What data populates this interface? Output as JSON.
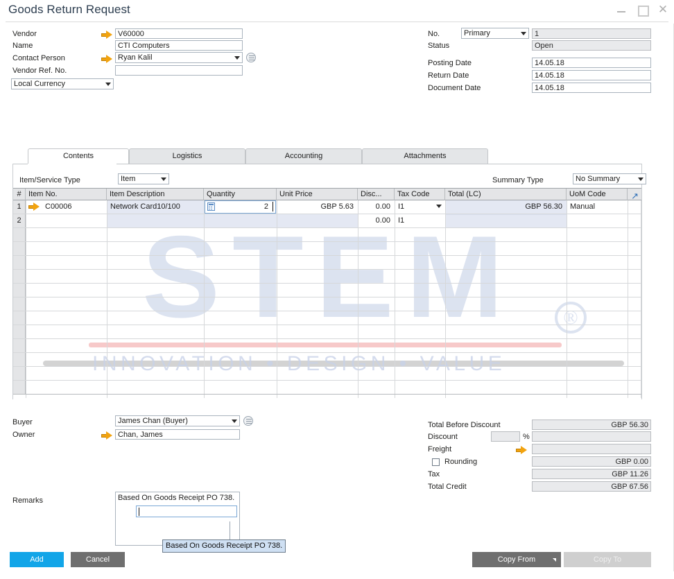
{
  "window": {
    "title": "Goods Return Request",
    "controls": [
      {
        "name": "minimize",
        "glyph": "—"
      },
      {
        "name": "maximize",
        "glyph": "□"
      },
      {
        "name": "close",
        "glyph": "×"
      }
    ]
  },
  "header_left": {
    "vendor_label": "Vendor",
    "vendor_value": "V60000",
    "name_label": "Name",
    "name_value": "CTI Computers",
    "contact_label": "Contact Person",
    "contact_value": "Ryan Kalil",
    "vendor_ref_label": "Vendor Ref. No.",
    "vendor_ref_value": "",
    "currency_value": "Local Currency"
  },
  "header_right": {
    "no_label": "No.",
    "no_series": "Primary",
    "no_value": "1",
    "status_label": "Status",
    "status_value": "Open",
    "posting_date_label": "Posting Date",
    "posting_date_value": "14.05.18",
    "return_date_label": "Return Date",
    "return_date_value": "14.05.18",
    "document_date_label": "Document Date",
    "document_date_value": "14.05.18"
  },
  "tabs": [
    {
      "label": "Contents",
      "active": true
    },
    {
      "label": "Logistics",
      "active": false
    },
    {
      "label": "Accounting",
      "active": false
    },
    {
      "label": "Attachments",
      "active": false
    }
  ],
  "content_toolbar": {
    "item_service_type_label": "Item/Service Type",
    "item_service_type_value": "Item",
    "summary_type_label": "Summary Type",
    "summary_type_value": "No Summary"
  },
  "grid": {
    "columns": [
      "#",
      "Item No.",
      "Item Description",
      "Quantity",
      "Unit Price",
      "Disc...",
      "Tax Code",
      "Total (LC)",
      "UoM Code"
    ],
    "rows": [
      {
        "num": "1",
        "item_no": "C00006",
        "description": "Network Card10/100",
        "quantity": "2",
        "unit_price": "GBP 5.63",
        "discount": "0.00",
        "tax_code": "I1",
        "total_lc": "GBP 56.30",
        "uom_code": "Manual"
      },
      {
        "num": "2",
        "item_no": "",
        "description": "",
        "quantity": "",
        "unit_price": "",
        "discount": "0.00",
        "tax_code": "I1",
        "total_lc": "",
        "uom_code": ""
      }
    ]
  },
  "footer_left": {
    "buyer_label": "Buyer",
    "buyer_value": "James Chan (Buyer)",
    "owner_label": "Owner",
    "owner_value": "Chan, James",
    "remarks_label": "Remarks",
    "remarks_value": "Based On Goods Receipt PO 738.",
    "remarks_tooltip": "Based On Goods Receipt PO 738."
  },
  "totals": {
    "total_before_discount_label": "Total Before Discount",
    "total_before_discount_value": "GBP 56.30",
    "discount_label": "Discount",
    "discount_pct_value": "",
    "discount_pct_sign": "%",
    "discount_value": "",
    "freight_label": "Freight",
    "freight_value": "",
    "rounding_label": "Rounding",
    "rounding_value": "GBP 0.00",
    "tax_label": "Tax",
    "tax_value": "GBP 11.26",
    "total_credit_label": "Total Credit",
    "total_credit_value": "GBP 67.56"
  },
  "buttons": {
    "add": "Add",
    "cancel": "Cancel",
    "copy_from": "Copy From",
    "copy_to": "Copy To"
  },
  "watermark": {
    "brand": "STEM",
    "registered": "®",
    "tagline": "INNOVATION • DESIGN • VALUE"
  },
  "colors": {
    "accent_blue": "#12a5e8",
    "gray_button": "#6f6f6f",
    "arrow_orange": "#f2a30f",
    "watermark_blue": "#c8d2e8"
  }
}
